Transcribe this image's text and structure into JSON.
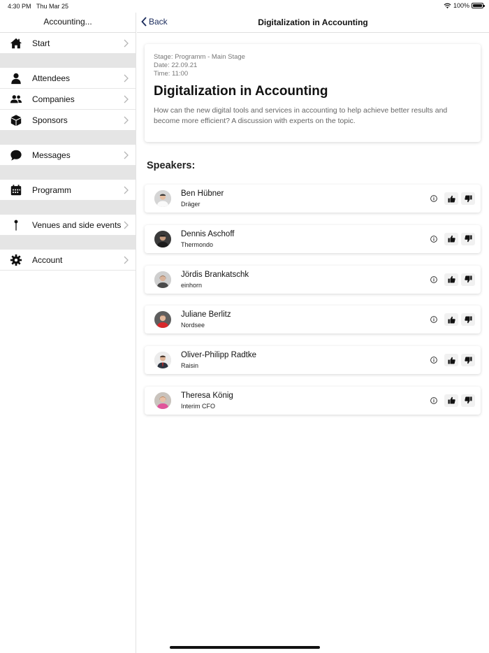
{
  "status_bar": {
    "time": "4:30 PM",
    "date": "Thu Mar 25",
    "battery": "100%"
  },
  "sidebar": {
    "title": "Accounting...",
    "items": [
      {
        "label": "Start",
        "icon": "home-icon"
      },
      {
        "label": "Attendees",
        "icon": "person-icon"
      },
      {
        "label": "Companies",
        "icon": "people-icon"
      },
      {
        "label": "Sponsors",
        "icon": "cube-icon"
      },
      {
        "label": "Messages",
        "icon": "chat-icon"
      },
      {
        "label": "Programm",
        "icon": "calendar-icon"
      },
      {
        "label": "Venues and side events",
        "icon": "pin-icon"
      },
      {
        "label": "Account",
        "icon": "gear-icon"
      }
    ]
  },
  "header": {
    "back_label": "Back",
    "title": "Digitalization in Accounting"
  },
  "session": {
    "stage": "Stage: Programm - Main Stage",
    "date": "Date: 22.09.21",
    "time": "Time: 11:00",
    "title": "Digitalization in Accounting",
    "description": "How can the new digital tools and services in accounting to help achieve better results and become more efficient? A discussion with experts on the topic."
  },
  "speakers_heading": "Speakers:",
  "speakers": [
    {
      "name": "Ben Hübner",
      "company": "Dräger"
    },
    {
      "name": "Dennis Aschoff",
      "company": "Thermondo"
    },
    {
      "name": "Jördis Brankatschk",
      "company": "einhorn"
    },
    {
      "name": "Juliane Berlitz",
      "company": "Nordsee"
    },
    {
      "name": "Oliver-Philipp Radtke",
      "company": "Raisin"
    },
    {
      "name": "Theresa König",
      "company": "Interim CFO"
    }
  ],
  "colors": {
    "accent": "#1a2b5c",
    "gap": "#e5e5e5"
  }
}
